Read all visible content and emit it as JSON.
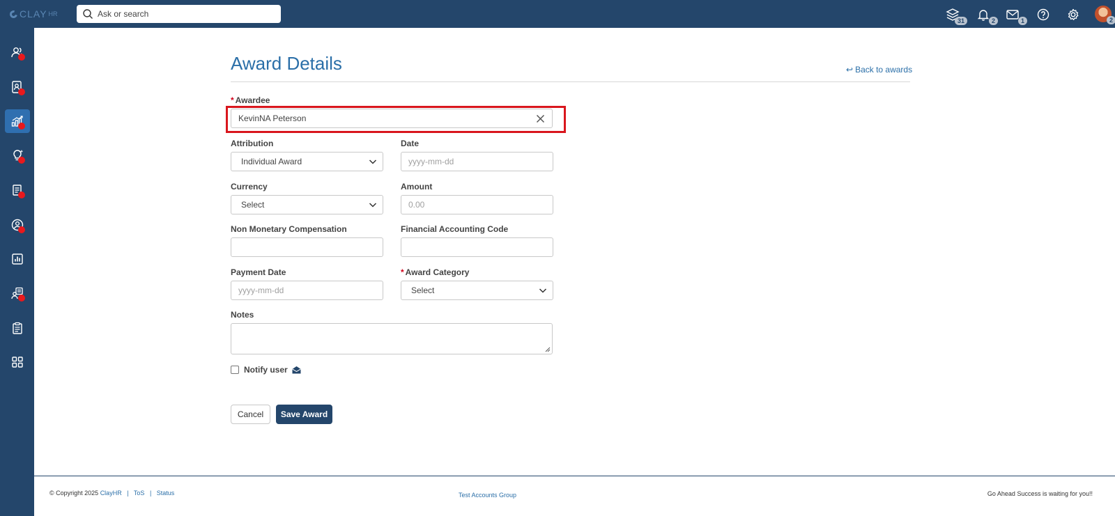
{
  "app": {
    "logo_text": "CLAY",
    "logo_suffix": "HR",
    "search_placeholder": "Ask or search"
  },
  "header_icons": [
    {
      "icon": "layers-icon",
      "badge": "31"
    },
    {
      "icon": "bell-icon",
      "badge": "2"
    },
    {
      "icon": "mail-icon",
      "badge": "1"
    },
    {
      "icon": "help-icon",
      "badge": ""
    },
    {
      "icon": "gear-icon",
      "badge": ""
    }
  ],
  "avatar_badge": "2",
  "sidebar": [
    {
      "icon": "people-icon",
      "active": false,
      "dot": true
    },
    {
      "icon": "id-card-icon",
      "active": false,
      "dot": true
    },
    {
      "icon": "growth-chart-icon",
      "active": true,
      "dot": true
    },
    {
      "icon": "lightbulb-icon",
      "active": false,
      "dot": true
    },
    {
      "icon": "documents-icon",
      "active": false,
      "dot": true
    },
    {
      "icon": "user-circle-icon",
      "active": false,
      "dot": true
    },
    {
      "icon": "report-icon",
      "active": false,
      "dot": false
    },
    {
      "icon": "recruit-icon",
      "active": false,
      "dot": true
    },
    {
      "icon": "clipboard-icon",
      "active": false,
      "dot": false
    },
    {
      "icon": "apps-grid-icon",
      "active": false,
      "dot": false
    }
  ],
  "page": {
    "title": "Award Details",
    "back_link": "Back to awards"
  },
  "form": {
    "awardee_label": "Awardee",
    "awardee_value": "KevinNA Peterson",
    "attribution_label": "Attribution",
    "attribution_value": "Individual Award",
    "date_label": "Date",
    "date_placeholder": "yyyy-mm-dd",
    "currency_label": "Currency",
    "currency_value": "Select",
    "amount_label": "Amount",
    "amount_placeholder": "0.00",
    "non_monetary_label": "Non Monetary Compensation",
    "non_monetary_value": "",
    "accounting_code_label": "Financial Accounting Code",
    "accounting_code_value": "",
    "payment_date_label": "Payment Date",
    "payment_date_placeholder": "yyyy-mm-dd",
    "award_category_label": "Award Category",
    "award_category_value": "Select",
    "notes_label": "Notes",
    "notes_value": "",
    "notify_label": "Notify user",
    "notify_checked": false,
    "cancel_label": "Cancel",
    "save_label": "Save Award"
  },
  "footer": {
    "copyright": "© Copyright 2025",
    "brand_link": "ClayHR",
    "tos_link": "ToS",
    "status_link": "Status",
    "center_text": "Test Accounts Group",
    "right_text": "Go Ahead Success is waiting for you!!"
  },
  "colors": {
    "navy": "#24466b",
    "accent_blue": "#2b6fa8",
    "active_sidebar": "#2f6fb0",
    "required": "#d0021b",
    "highlight_red": "#d9161d"
  }
}
